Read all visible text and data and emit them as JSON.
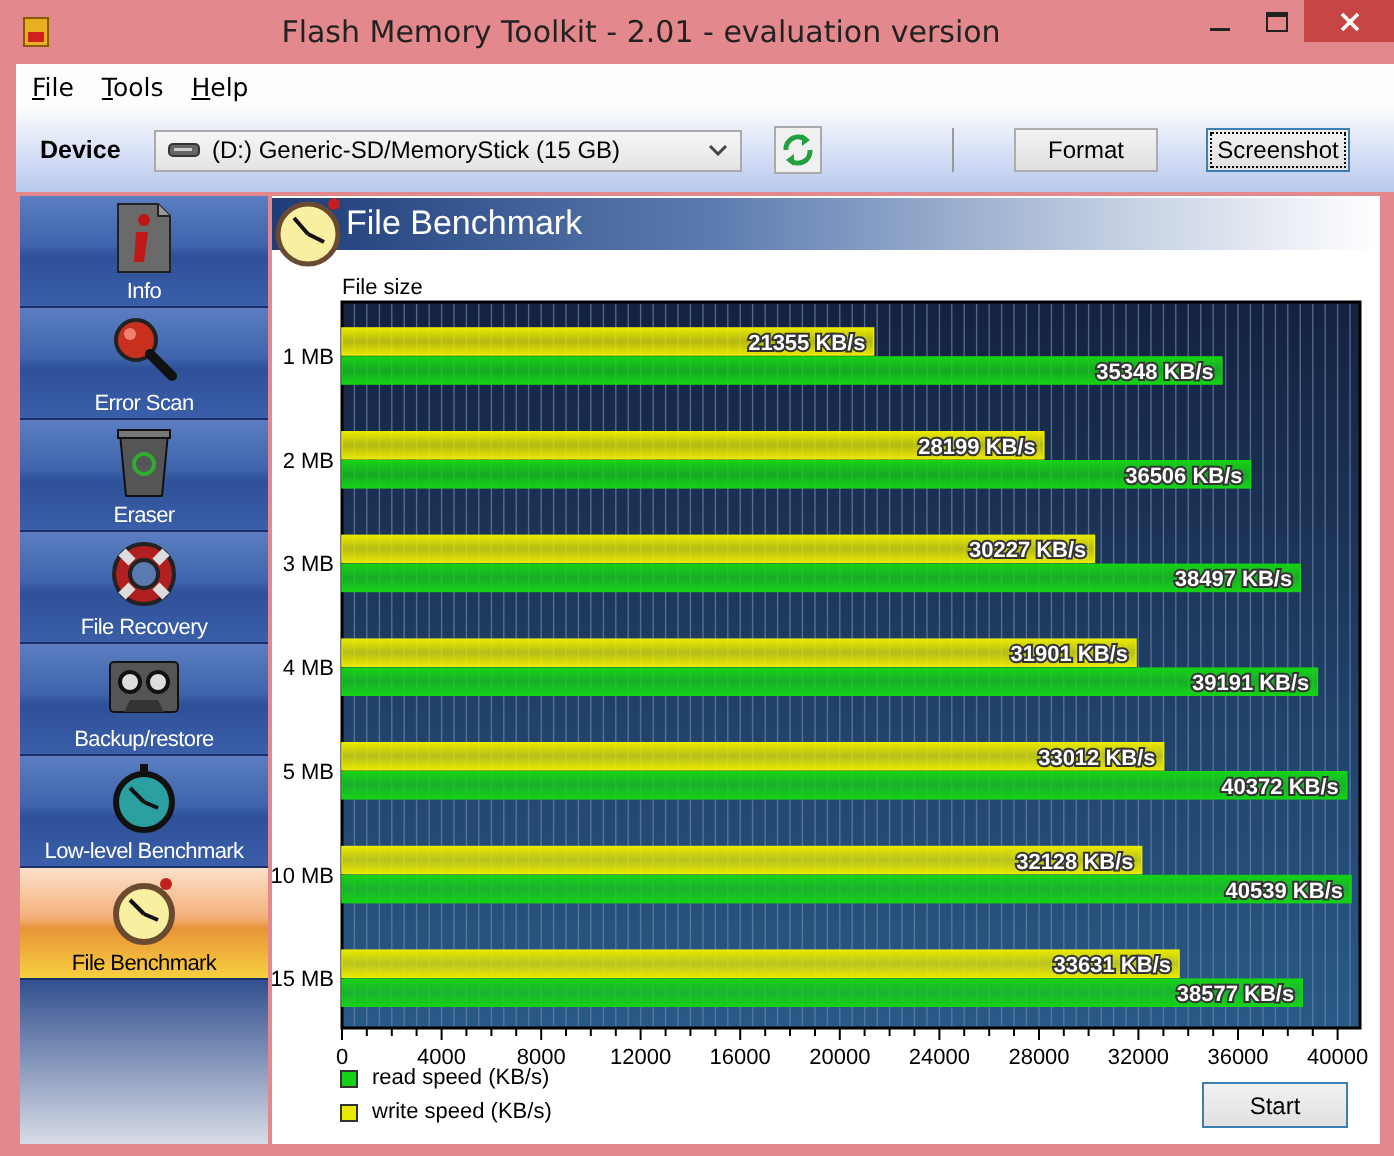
{
  "window": {
    "title": "Flash Memory Toolkit - 2.01 - evaluation version"
  },
  "menu": [
    {
      "label": "File"
    },
    {
      "label": "Tools"
    },
    {
      "label": "Help"
    }
  ],
  "toolbar": {
    "device_label": "Device",
    "device": "(D:) Generic-SD/MemoryStick (15 GB)",
    "buttons": [
      {
        "label": "Format",
        "focused": false
      },
      {
        "label": "Screenshot",
        "focused": true
      }
    ]
  },
  "sidebar": {
    "items": [
      {
        "label": "Info",
        "selected": false
      },
      {
        "label": "Error Scan",
        "selected": false
      },
      {
        "label": "Eraser",
        "selected": false
      },
      {
        "label": "File Recovery",
        "selected": false
      },
      {
        "label": "Backup/restore",
        "selected": false
      },
      {
        "label": "Low-level Benchmark",
        "selected": false
      },
      {
        "label": "File Benchmark",
        "selected": true
      }
    ]
  },
  "panel": {
    "title": "File Benchmark",
    "chart_data": {
      "type": "bar",
      "orientation": "horizontal",
      "ylabel": "File size",
      "categories": [
        "1 MB",
        "2 MB",
        "3 MB",
        "4 MB",
        "5 MB",
        "10 MB",
        "15 MB"
      ],
      "series": [
        {
          "name": "write speed (KB/s)",
          "color": "#e8e800",
          "values": [
            21355,
            28199,
            30227,
            31901,
            33012,
            32128,
            33631
          ]
        },
        {
          "name": "read speed (KB/s)",
          "color": "#16d216",
          "values": [
            35348,
            36506,
            38497,
            39191,
            40372,
            40539,
            38577
          ]
        }
      ],
      "value_labels": [
        [
          "21355 KB/s",
          "28199 KB/s",
          "30227 KB/s",
          "31901 KB/s",
          "33012 KB/s",
          "32128 KB/s",
          "33631 KB/s"
        ],
        [
          "35348 KB/s",
          "36506 KB/s",
          "38497 KB/s",
          "39191 KB/s",
          "40372 KB/s",
          "40539 KB/s",
          "38577 KB/s"
        ]
      ],
      "grid": true,
      "xlim": [
        0,
        40900
      ],
      "xticks": [
        0,
        4000,
        8000,
        12000,
        16000,
        20000,
        24000,
        28000,
        32000,
        36000,
        40000
      ]
    },
    "start_button": "Start"
  }
}
